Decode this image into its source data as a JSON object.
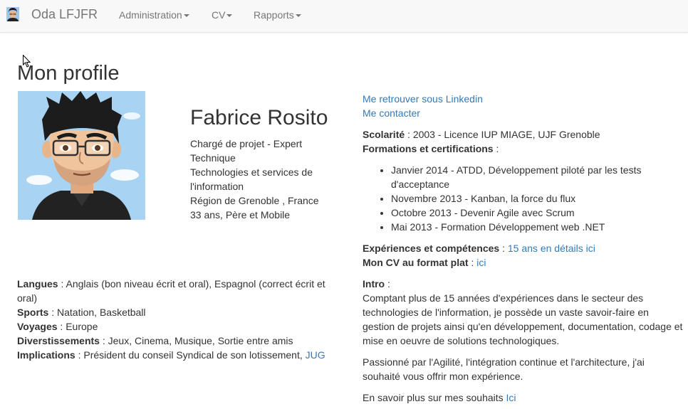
{
  "navbar": {
    "brand": "Oda LFJFR",
    "menu": [
      {
        "label": "Administration"
      },
      {
        "label": "CV"
      },
      {
        "label": "Rapports"
      }
    ]
  },
  "page": {
    "title": "Mon profile"
  },
  "profile": {
    "name": "Fabrice Rosito",
    "bio": [
      "Chargé de projet - Expert Technique",
      "Technologies et services de l'information",
      "Région de Grenoble , France",
      "33 ans, Père et Mobile"
    ]
  },
  "personal": {
    "langues_label": "Langues",
    "langues_value": "Anglais (bon niveau écrit et oral), Espagnol (correct écrit et oral)",
    "sports_label": "Sports",
    "sports_value": "Natation, Basketball",
    "voyages_label": "Voyages",
    "voyages_value": "Europe",
    "divertissements_label": "Diverstissements",
    "divertissements_value": "Jeux, Cinema, Musique, Sortie entre amis",
    "implications_label": "Implications",
    "implications_value": "Président du conseil Syndical de son lotissement,",
    "implications_link": "JUG"
  },
  "links": {
    "linkedin": "Me retrouver sous Linkedin",
    "contact": "Me contacter"
  },
  "education": {
    "scolarite_label": "Scolarité",
    "scolarite_value": "2003 - Licence IUP MIAGE, UJF Grenoble",
    "formations_label": "Formations et certifications",
    "formations": [
      "Janvier 2014 - ATDD, Développement piloté par les tests d'acceptance",
      "Novembre 2013 - Kanban, la force du flux",
      "Octobre 2013 - Devenir Agile avec Scrum",
      "Mai 2013 - Formation Développement web .NET"
    ]
  },
  "experience": {
    "label": "Expériences et compétences",
    "link": "15 ans en détails ici",
    "cv_label": "Mon CV au format plat",
    "cv_link": "ici"
  },
  "intro": {
    "label": "Intro",
    "paragraph1": "Comptant plus de 15 années d'expériences dans le secteur des technologies de l'information, je possède un vaste savoir-faire en gestion de projets ainsi qu'en développement, documentation, codage et mise en oeuvre de solutions technologiques.",
    "paragraph2": "Passionné par l'Agilité, l'intégration continue et l'architecture, j'ai souhaité vous offrir mon expérience.",
    "more_text": "En savoir plus sur mes souhaits",
    "more_link": "Ici"
  },
  "colors": {
    "link": "#337ab7",
    "navbar_bg": "#f8f8f8",
    "navbar_text": "#777777",
    "text": "#333333"
  }
}
